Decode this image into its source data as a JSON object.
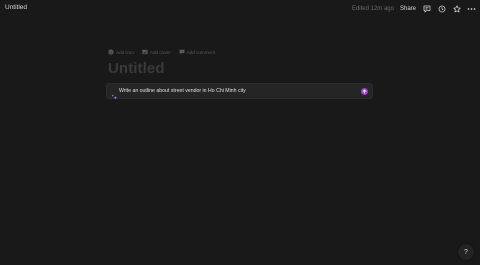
{
  "topbar": {
    "page_title": "Untitled",
    "edited": "Edited 12m ago",
    "share_label": "Share",
    "icons": [
      "comment-icon",
      "clock-icon",
      "star-icon",
      "more-icon"
    ]
  },
  "page_actions": [
    {
      "label": "Add icon",
      "icon": "smiley-icon"
    },
    {
      "label": "Add cover",
      "icon": "image-icon"
    },
    {
      "label": "Add comment",
      "icon": "comment-icon"
    }
  ],
  "title_placeholder": "Untitled",
  "ai_prompt": {
    "value": "Write an outline about street vendor in Ho Chi Minh city",
    "accent": "#a33fd4"
  },
  "help_label": "?"
}
